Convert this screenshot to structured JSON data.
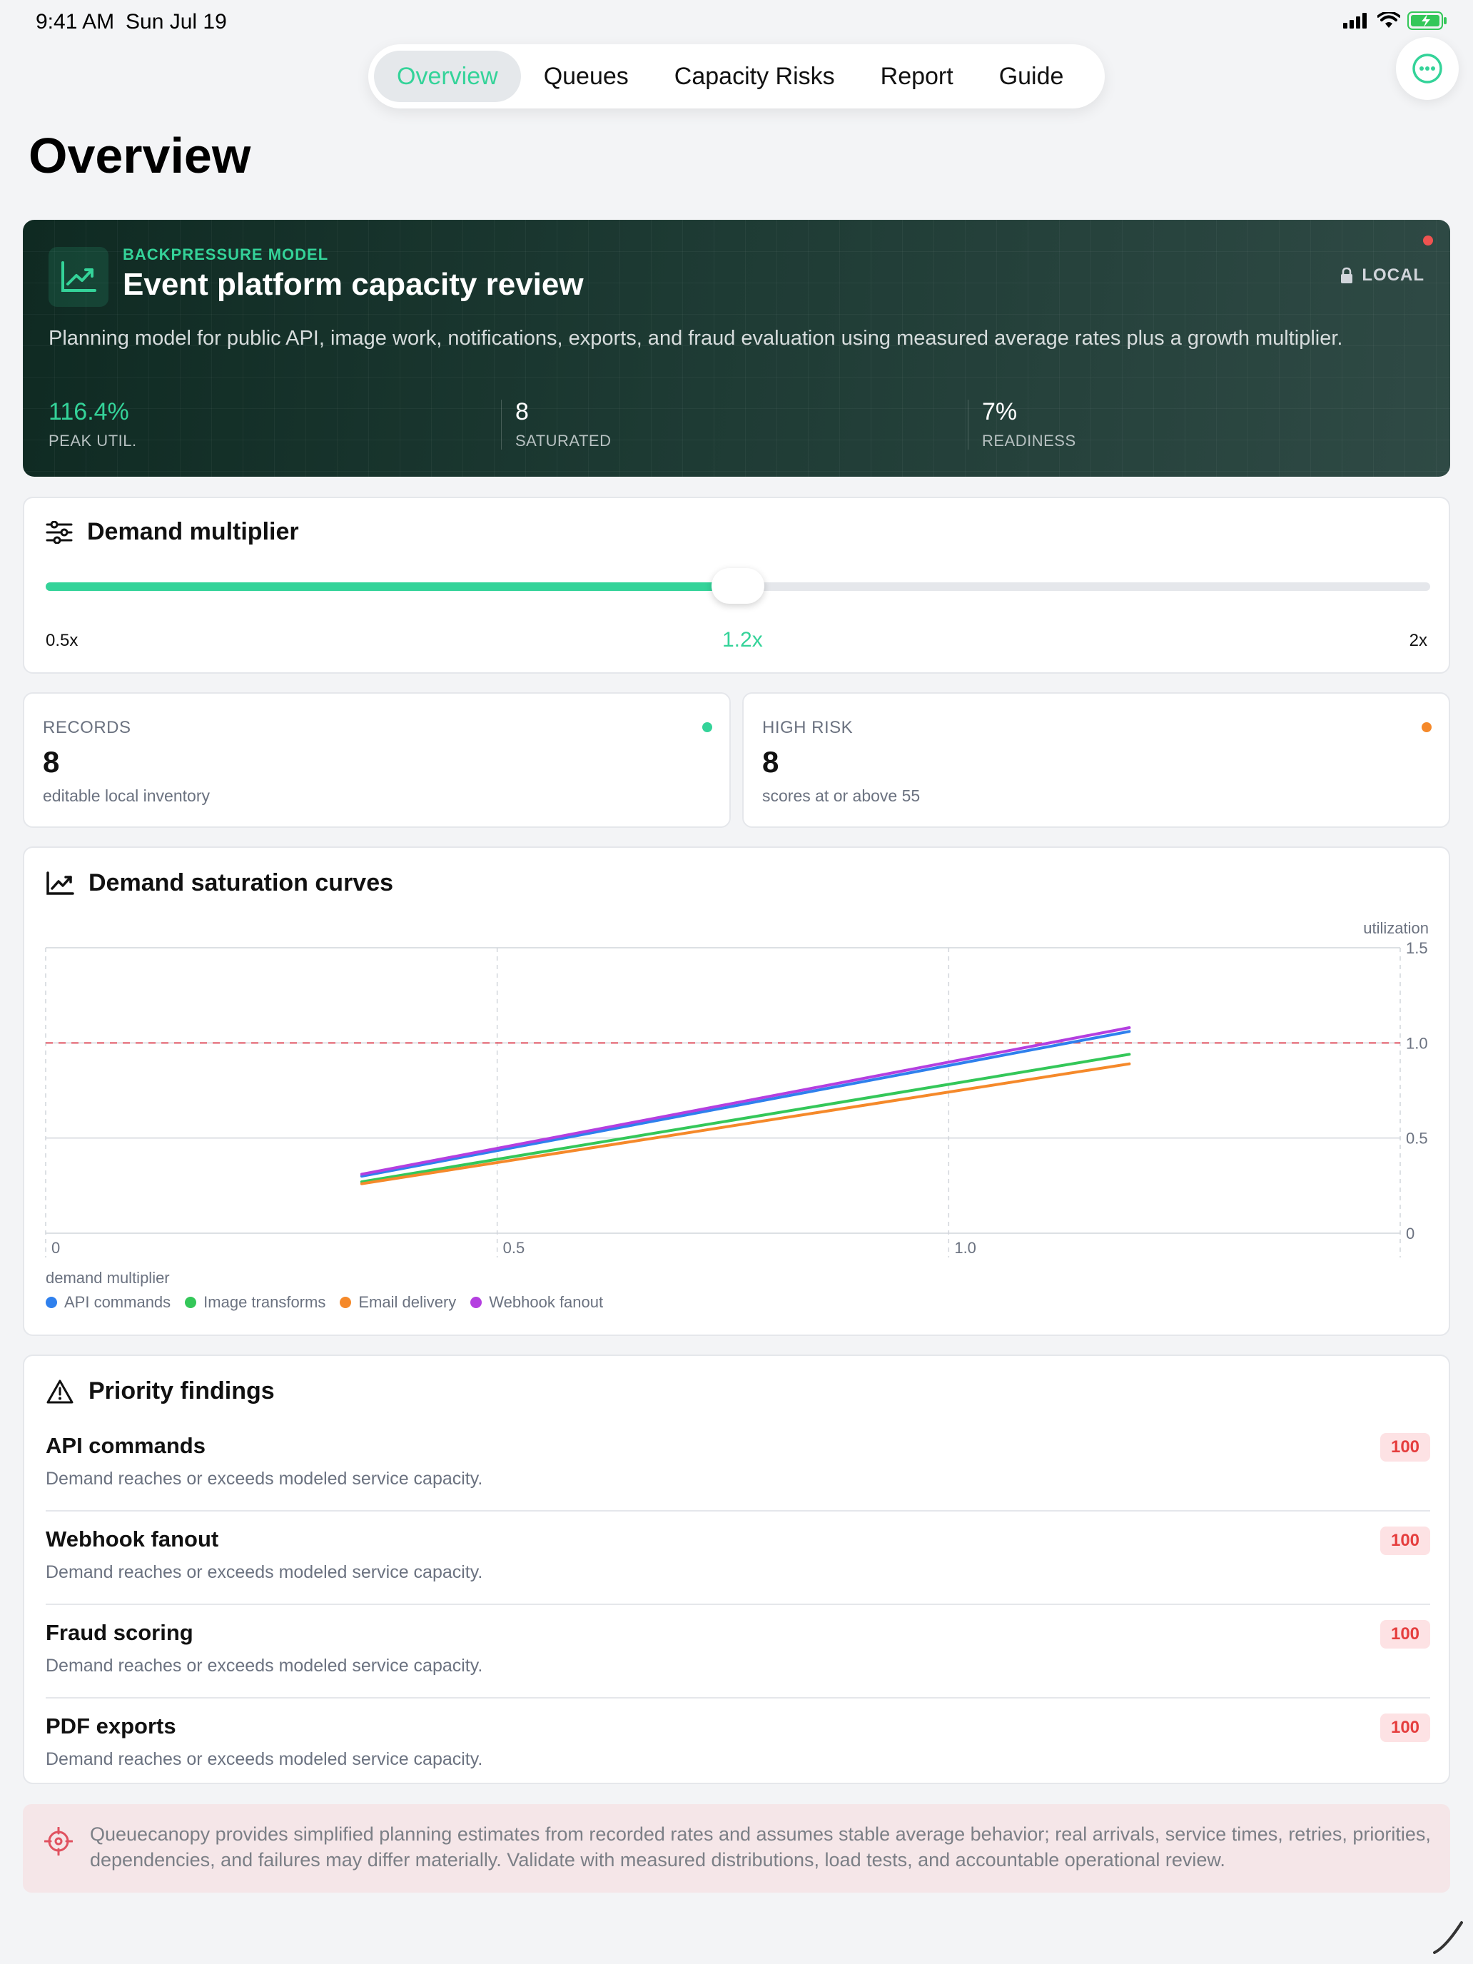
{
  "status": {
    "time": "9:41 AM",
    "date": "Sun Jul 19"
  },
  "tabs": [
    "Overview",
    "Queues",
    "Capacity Risks",
    "Report",
    "Guide"
  ],
  "page_title": "Overview",
  "hero": {
    "kicker": "BACKPRESSURE MODEL",
    "title": "Event platform capacity review",
    "badge": "LOCAL",
    "description": "Planning model for public API, image work, notifications, exports, and fraud evaluation using measured average rates plus a growth multiplier.",
    "stats": [
      {
        "value": "116.4%",
        "label": "PEAK UTIL."
      },
      {
        "value": "8",
        "label": "SATURATED"
      },
      {
        "value": "7%",
        "label": "READINESS"
      }
    ]
  },
  "demand_multiplier": {
    "title": "Demand multiplier",
    "min_label": "0.5x",
    "value_label": "1.2x",
    "max_label": "2x",
    "fraction": 0.5
  },
  "metrics": [
    {
      "label": "RECORDS",
      "value": "8",
      "note": "editable local inventory",
      "color": "#34d399"
    },
    {
      "label": "HIGH RISK",
      "value": "8",
      "note": "scores at or above 55",
      "color": "#f5892a"
    }
  ],
  "chart_card": {
    "title": "Demand saturation curves"
  },
  "chart_data": {
    "type": "line",
    "ylabel": "utilization",
    "xlabel": "demand multiplier",
    "xlim": [
      0,
      1.5
    ],
    "ylim": [
      0,
      1.5
    ],
    "x_ticks": [
      "0",
      "0.5",
      "1.0"
    ],
    "y_ticks": [
      "1.5",
      "1.0",
      "0.5",
      "0"
    ],
    "threshold": 1.0,
    "series": [
      {
        "name": "API commands",
        "color": "#2f80ed",
        "x": [
          0.35,
          1.2
        ],
        "y": [
          0.3,
          1.06
        ]
      },
      {
        "name": "Image transforms",
        "color": "#34c759",
        "x": [
          0.35,
          1.2
        ],
        "y": [
          0.27,
          0.94
        ]
      },
      {
        "name": "Email delivery",
        "color": "#f5892a",
        "x": [
          0.35,
          1.2
        ],
        "y": [
          0.26,
          0.89
        ]
      },
      {
        "name": "Webhook fanout",
        "color": "#b43fe0",
        "x": [
          0.35,
          1.2
        ],
        "y": [
          0.31,
          1.08
        ]
      }
    ]
  },
  "findings": {
    "title": "Priority findings",
    "items": [
      {
        "title": "API commands",
        "desc": "Demand reaches or exceeds modeled service capacity.",
        "score": "100"
      },
      {
        "title": "Webhook fanout",
        "desc": "Demand reaches or exceeds modeled service capacity.",
        "score": "100"
      },
      {
        "title": "Fraud scoring",
        "desc": "Demand reaches or exceeds modeled service capacity.",
        "score": "100"
      },
      {
        "title": "PDF exports",
        "desc": "Demand reaches or exceeds modeled service capacity.",
        "score": "100"
      }
    ]
  },
  "disclaimer": "Queuecanopy provides simplified planning estimates from recorded rates and assumes stable average behavior; real arrivals, service times, retries, priorities, dependencies, and failures may differ materially. Validate with measured distributions, load tests, and accountable operational review.",
  "icons": {
    "hero": "trending-up-icon",
    "lock": "lock-icon",
    "sliders": "sliders-icon",
    "chart": "line-chart-icon",
    "warning": "warning-triangle-icon",
    "crosshair": "crosshair-icon",
    "more": "more-icon"
  }
}
